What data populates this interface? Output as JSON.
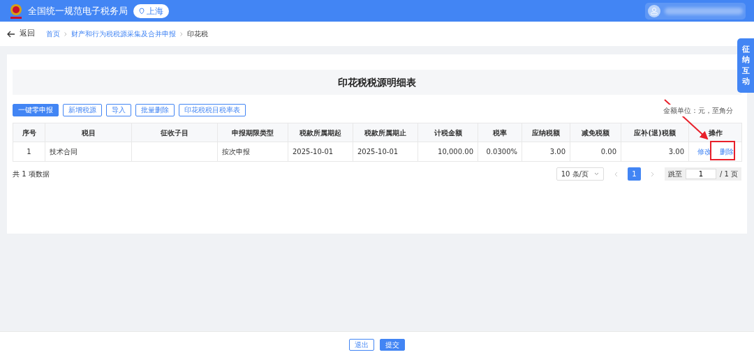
{
  "header": {
    "title": "全国统一规范电子税务局",
    "location": "上海"
  },
  "breadcrumb": {
    "back": "返回",
    "items": [
      "首页",
      "财产和行为税税源采集及合并申报",
      "印花税"
    ]
  },
  "side_tab": "征纳互动",
  "page_title": "印花税税源明细表",
  "toolbar": [
    {
      "label": "一键零申报",
      "kind": "primary"
    },
    {
      "label": "新增税源",
      "kind": "outline"
    },
    {
      "label": "导入",
      "kind": "outline"
    },
    {
      "label": "批量删除",
      "kind": "outline"
    },
    {
      "label": "印花税税目税率表",
      "kind": "outline"
    }
  ],
  "unit_note": "金额单位：元，至角分",
  "table": {
    "columns": [
      {
        "label": "序号",
        "kind": "index"
      },
      {
        "label": "税目",
        "kind": "text"
      },
      {
        "label": "征收子目",
        "kind": "text"
      },
      {
        "label": "申报期限类型",
        "kind": "text"
      },
      {
        "label": "税款所属期起",
        "kind": "text"
      },
      {
        "label": "税款所属期止",
        "kind": "text"
      },
      {
        "label": "计税金额",
        "kind": "amount"
      },
      {
        "label": "税率",
        "kind": "amount"
      },
      {
        "label": "应纳税额",
        "kind": "amount"
      },
      {
        "label": "减免税额",
        "kind": "amount"
      },
      {
        "label": "应补(退)税额",
        "kind": "amount"
      },
      {
        "label": "操作",
        "kind": "actions"
      }
    ],
    "rows": [
      {
        "cells": [
          "1",
          "技术合同",
          "",
          "按次申报",
          "2025-10-01",
          "2025-10-01",
          "10,000.00",
          "0.0300%",
          "3.00",
          "0.00",
          "3.00"
        ],
        "actions": [
          "修改",
          "删除"
        ]
      }
    ]
  },
  "pagination": {
    "total": "共 1 项数据",
    "page_size": "10 条/页",
    "pages": [
      {
        "label": "1",
        "selected": true
      }
    ],
    "jump_label": "跳至",
    "jump_value": "1",
    "page_count": "/ 1 页"
  },
  "footer_buttons": [
    {
      "label": "退出",
      "kind": "outline"
    },
    {
      "label": "提交",
      "kind": "primary"
    }
  ]
}
